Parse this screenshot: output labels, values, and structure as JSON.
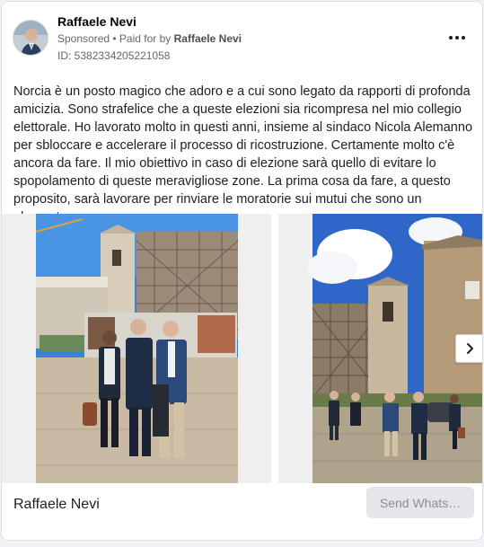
{
  "advertiser": {
    "name": "Raffaele Nevi",
    "sponsored_label": "Sponsored",
    "separator": " • ",
    "paid_for_prefix": "Paid for by ",
    "paid_for_name": "Raffaele Nevi",
    "ad_id": "ID: 5382334205221058"
  },
  "post": {
    "text": "Norcia è un posto magico che adoro e a cui sono legato da rapporti di profonda amicizia. Sono strafelice che a queste elezioni sia ricompresa nel mio collegio elettorale. Ho lavorato molto in questi anni, insieme al sindaco Nicola Alemanno per sbloccare e accelerare il processo di ricostruzione. Certamente molto c'è ancora da fare. Il mio obiettivo in caso di elezione sarà quello di evitare lo spopolamento di queste meravigliose zone. La prima cosa da fare, a questo proposito, sarà lavorare per rinviare le moratorie sui mutui che sono un elemento …"
  },
  "footer": {
    "page_name": "Raffaele Nevi",
    "cta_label": "Send Whats…"
  },
  "icons": {
    "more": "more-options-icon",
    "next": "chevron-right-icon"
  },
  "colors": {
    "sky": "#4a90e2",
    "scaffold": "#8a7a68",
    "stone": "#c9b79c",
    "cta_bg": "#e4e6eb"
  }
}
